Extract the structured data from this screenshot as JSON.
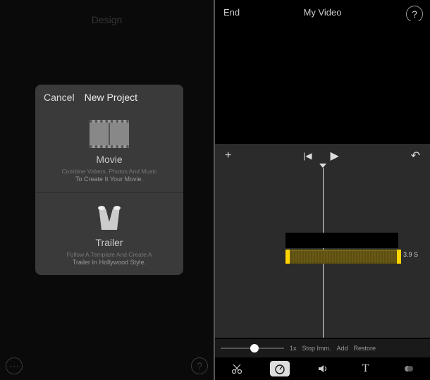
{
  "left": {
    "bg_title": "Design",
    "dialog": {
      "cancel": "Cancel",
      "title": "New Project",
      "movie": {
        "label": "Movie",
        "desc1": "Combine Videos, Photos And Music",
        "desc2": "To Create It Your Movie."
      },
      "trailer": {
        "label": "Trailer",
        "desc1": "Follow A Template And Create A",
        "desc2": "Trailer In Hollywood Style."
      }
    },
    "more": "⋯",
    "help": "?"
  },
  "right": {
    "end": "End",
    "title": "My Video",
    "time": "3.9 s",
    "help": "?",
    "zoom": "⊕",
    "controls": {
      "add": "+",
      "skip_back": "|◀",
      "play": "▶",
      "undo": "↶"
    },
    "clip_duration": "3.9 S",
    "speed": {
      "value": "1x",
      "stop": "Stop Imm.",
      "add": "Add",
      "restore": "Restore"
    },
    "tools": {
      "cut": "✂",
      "speed": "⌕",
      "volume": "🔊",
      "text": "T",
      "filter": "●"
    }
  }
}
